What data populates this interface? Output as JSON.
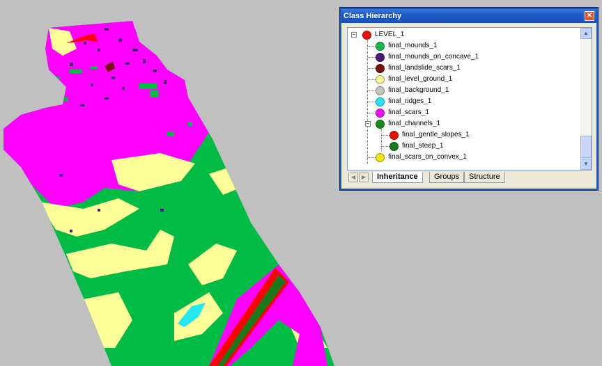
{
  "window": {
    "title": "Class Hierarchy",
    "close_glyph": "✕"
  },
  "tree": {
    "items": [
      {
        "label": "LEVEL_1",
        "color": "#e8100c",
        "icon": "class-dot-icon"
      },
      {
        "label": "final_mounds_1",
        "color": "#14b84a",
        "icon": "class-dot-icon"
      },
      {
        "label": "final_mounds_on_concave_1",
        "color": "#4a1a78",
        "icon": "class-dot-icon"
      },
      {
        "label": "final_landslide_scars_1",
        "color": "#7a0f0f",
        "icon": "class-dot-icon"
      },
      {
        "label": "final_level_ground_1",
        "color": "#f6f49a",
        "icon": "class-dot-icon"
      },
      {
        "label": "final_background_1",
        "color": "#c4c4c4",
        "icon": "class-dot-icon"
      },
      {
        "label": "final_ridges_1",
        "color": "#22e8f4",
        "icon": "class-dot-icon"
      },
      {
        "label": "final_scars_1",
        "color": "#ee10ee",
        "icon": "class-dot-icon"
      },
      {
        "label": "final_channels_1",
        "color": "#1a8a1a",
        "icon": "class-dot-icon"
      },
      {
        "label": "final_gentle_slopes_1",
        "color": "#e8100c",
        "icon": "class-dot-icon"
      },
      {
        "label": "final_steep_1",
        "color": "#1a7a1a",
        "icon": "class-dot-icon"
      },
      {
        "label": "final_scars_on_convex_1",
        "color": "#f4e414",
        "icon": "class-dot-icon"
      }
    ],
    "expander_glyph": "−"
  },
  "tabs": [
    {
      "label": "Inheritance",
      "active": true
    },
    {
      "label": "Groups",
      "active": false
    },
    {
      "label": "Structure",
      "active": false
    }
  ],
  "colors": {
    "background": "#c0c0c0",
    "scars": "#ff00ff",
    "mounds": "#00bb44",
    "level_ground": "#ffff99",
    "mounds_on_concave": "#4b1a7a",
    "landslide_scars": "#7a1010",
    "gentle_slopes": "#ff0000",
    "steep": "#1a7a1a",
    "ridges": "#22e8f4"
  }
}
